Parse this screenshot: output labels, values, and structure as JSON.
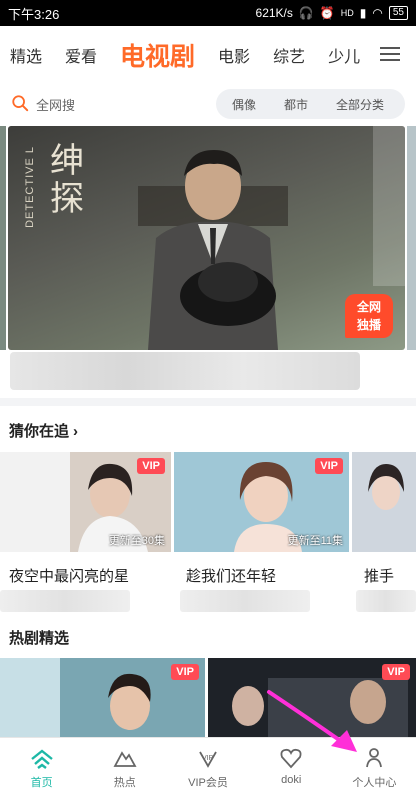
{
  "status_bar": {
    "time": "下午3:26",
    "speed": "621K/s",
    "signal1": "HD",
    "battery": "55"
  },
  "top_nav": {
    "tabs": [
      "精选",
      "爱看",
      "电视剧",
      "电影",
      "综艺",
      "少儿"
    ],
    "active_index": 2,
    "active_color": "#ff6a28"
  },
  "search": {
    "placeholder": "全网搜",
    "filters": [
      "偶像",
      "都市",
      "全部分类"
    ]
  },
  "banner": {
    "title_cn": "绅探",
    "title_en": "DETECTIVE L",
    "badge_line1": "全网",
    "badge_line2": "独播"
  },
  "section_following": {
    "title": "猜你在追",
    "items": [
      {
        "title": "夜空中最闪亮的星",
        "update": "更新至30集",
        "badge": "VIP"
      },
      {
        "title": "趁我们还年轻",
        "update": "更新至11集",
        "badge": "VIP"
      },
      {
        "title": "推手",
        "update": "",
        "badge": ""
      }
    ]
  },
  "section_hot": {
    "title": "热剧精选",
    "items": [
      {
        "badge": "VIP"
      },
      {
        "badge": "VIP"
      }
    ]
  },
  "bottom_nav": {
    "items": [
      {
        "label": "首页",
        "icon": "home-icon"
      },
      {
        "label": "热点",
        "icon": "mountain-icon"
      },
      {
        "label": "VIP会员",
        "icon": "vip-icon"
      },
      {
        "label": "doki",
        "icon": "heart-icon"
      },
      {
        "label": "个人中心",
        "icon": "person-icon"
      }
    ],
    "active_index": 0,
    "active_color": "#1db8a6"
  },
  "colors": {
    "accent": "#ff6a28",
    "vip": "#ff4b55",
    "arrow": "#ff2fd8"
  }
}
